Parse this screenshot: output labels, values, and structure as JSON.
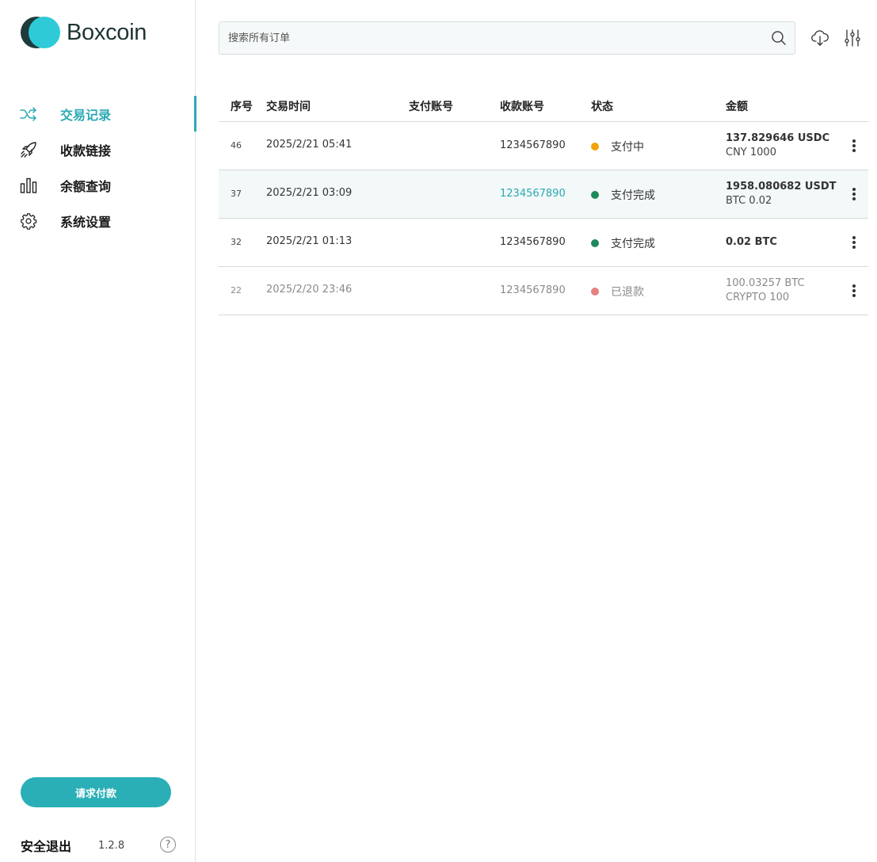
{
  "brand": {
    "name": "Boxcoin",
    "accent": "#2aa9b4",
    "dark": "#1f3b3b",
    "light": "#2ecad8"
  },
  "sidebar": {
    "items": [
      {
        "label": "交易记录",
        "icon": "shuffle-icon",
        "active": true
      },
      {
        "label": "收款链接",
        "icon": "rocket-icon",
        "active": false
      },
      {
        "label": "余额查询",
        "icon": "bar-chart-icon",
        "active": false
      },
      {
        "label": "系统设置",
        "icon": "gear-icon",
        "active": false
      }
    ],
    "request_button": "请求付款",
    "logout": "安全退出",
    "version": "1.2.8",
    "help": "?"
  },
  "search": {
    "placeholder": "搜索所有订单",
    "value": ""
  },
  "toolbar": {
    "download_icon": "cloud-download-icon",
    "filter_icon": "sliders-icon"
  },
  "table": {
    "headers": {
      "id": "序号",
      "time": "交易时间",
      "pay_account": "支付账号",
      "recv_account": "收款账号",
      "status": "状态",
      "amount": "金额"
    },
    "rows": [
      {
        "id": "46",
        "time": "2025/2/21 05:41",
        "pay_account": "",
        "recv_account": "1234567890",
        "status": "支付中",
        "status_color": "#f0a30a",
        "amount": "137.829646 USDC",
        "amount_sub": "CNY 1000"
      },
      {
        "id": "37",
        "time": "2025/2/21 03:09",
        "pay_account": "",
        "recv_account": "1234567890",
        "status": "支付完成",
        "status_color": "#1e8a5c",
        "amount": "1958.080682 USDT",
        "amount_sub": "BTC 0.02"
      },
      {
        "id": "32",
        "time": "2025/2/21 01:13",
        "pay_account": "",
        "recv_account": "1234567890",
        "status": "支付完成",
        "status_color": "#1e8a5c",
        "amount": "0.02 BTC",
        "amount_sub": ""
      },
      {
        "id": "22",
        "time": "2025/2/20 23:46",
        "pay_account": "",
        "recv_account": "1234567890",
        "status": "已退款",
        "status_color": "#e48080",
        "amount": "100.03257 BTC",
        "amount_sub": "CRYPTO 100"
      }
    ]
  }
}
